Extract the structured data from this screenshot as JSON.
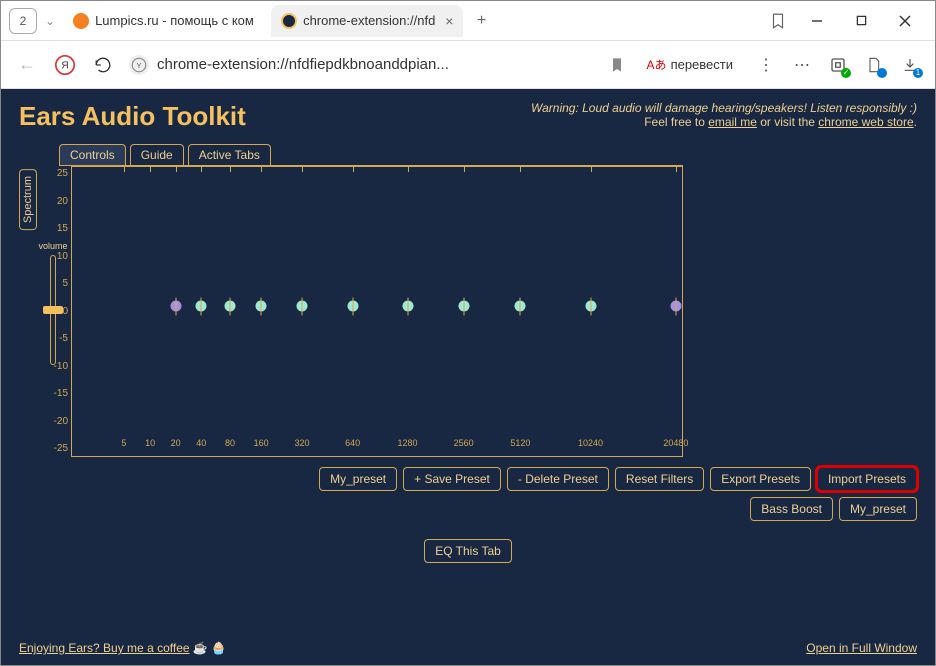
{
  "window": {
    "tab_counter": "2",
    "tabs": [
      {
        "title": "Lumpics.ru - помощь с ком",
        "active": false,
        "icon_color": "#f58020"
      },
      {
        "title": "chrome-extension://nfd",
        "active": true,
        "icon_color": "#f5c060"
      }
    ]
  },
  "toolbar": {
    "url": "chrome-extension://nfdfiepdkbnoanddpian...",
    "translate_label": "перевести"
  },
  "app": {
    "title": "Ears Audio Toolkit",
    "warning_text": "Warning: Loud audio will damage hearing/speakers! Listen responsibly :)",
    "warning_sub_prefix": "Feel free to ",
    "warning_email": "email me",
    "warning_sub_mid": " or visit the ",
    "warning_store": "chrome web store",
    "tabs": [
      {
        "label": "Controls",
        "active": true
      },
      {
        "label": "Guide",
        "active": false
      },
      {
        "label": "Active Tabs",
        "active": false
      }
    ],
    "spectrum_label": "Spectrum",
    "volume_label": "volume",
    "y_ticks": [
      "25",
      "20",
      "15",
      "10",
      "5",
      "0",
      "-5",
      "-10",
      "-15",
      "-20",
      "-25"
    ],
    "freq_labels": [
      {
        "v": "5",
        "p": 8.5
      },
      {
        "v": "10",
        "p": 12.8
      },
      {
        "v": "20",
        "p": 17
      },
      {
        "v": "40",
        "p": 21.2
      },
      {
        "v": "80",
        "p": 25.9
      },
      {
        "v": "160",
        "p": 31
      },
      {
        "v": "320",
        "p": 37.7
      },
      {
        "v": "640",
        "p": 46
      },
      {
        "v": "1280",
        "p": 55
      },
      {
        "v": "2560",
        "p": 64.2
      },
      {
        "v": "5120",
        "p": 73.5
      },
      {
        "v": "10240",
        "p": 85
      },
      {
        "v": "20480",
        "p": 99
      }
    ],
    "dots": [
      {
        "p": 17,
        "c": "dot-purple"
      },
      {
        "p": 21.2,
        "c": "dot-mint"
      },
      {
        "p": 25.9,
        "c": "dot-mint"
      },
      {
        "p": 31,
        "c": "dot-mint"
      },
      {
        "p": 37.7,
        "c": "dot-mint"
      },
      {
        "p": 46,
        "c": "dot-mint"
      },
      {
        "p": 55,
        "c": "dot-mint"
      },
      {
        "p": 64.2,
        "c": "dot-mint"
      },
      {
        "p": 73.5,
        "c": "dot-mint"
      },
      {
        "p": 85,
        "c": "dot-mint"
      },
      {
        "p": 99,
        "c": "dot-purple"
      }
    ],
    "buttons_row1": [
      {
        "label": "My_preset",
        "name": "preset-select"
      },
      {
        "label": "+ Save Preset",
        "name": "save-preset-button"
      },
      {
        "label": "- Delete Preset",
        "name": "delete-preset-button"
      },
      {
        "label": "Reset Filters",
        "name": "reset-filters-button"
      },
      {
        "label": "Export Presets",
        "name": "export-presets-button"
      },
      {
        "label": "Import Presets",
        "name": "import-presets-button",
        "highlighted": true
      }
    ],
    "buttons_row2": [
      {
        "label": "Bass Boost",
        "name": "bass-boost-button"
      },
      {
        "label": "My_preset",
        "name": "my-preset-button"
      }
    ],
    "eq_this_tab": "EQ This Tab",
    "footer_left": "Enjoying Ears? Buy me a coffee",
    "footer_emoji": "☕ 🧁",
    "footer_right": "Open in Full Window"
  }
}
